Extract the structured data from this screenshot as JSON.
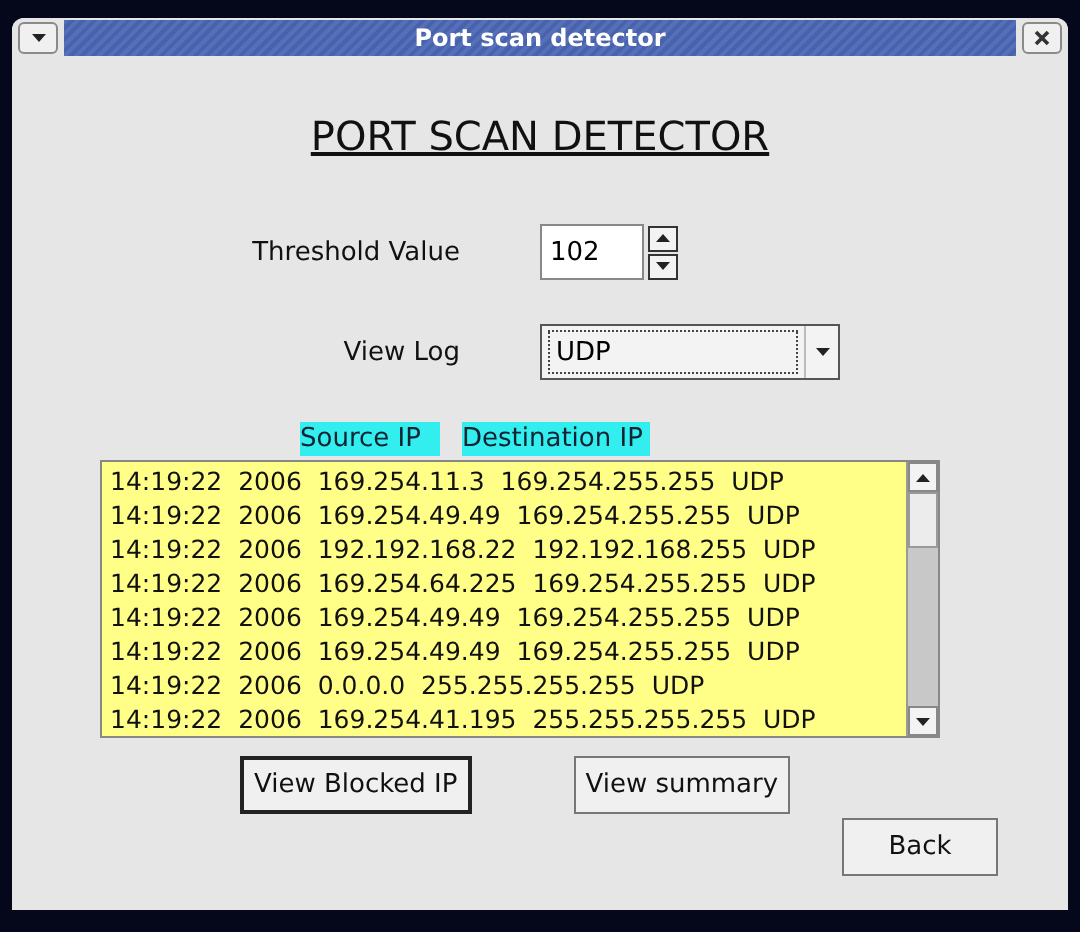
{
  "window": {
    "title": "Port scan detector"
  },
  "heading": "PORT SCAN DETECTOR",
  "threshold": {
    "label": "Threshold Value",
    "value": "102"
  },
  "view_log": {
    "label": "View Log",
    "value": "UDP"
  },
  "column_headers": [
    "Source IP",
    "Destination IP"
  ],
  "log_rows": [
    {
      "time": "14:19:22",
      "year": "2006",
      "source": "169.254.11.3",
      "destination": "169.254.255.255",
      "protocol": "UDP"
    },
    {
      "time": "14:19:22",
      "year": "2006",
      "source": "169.254.49.49",
      "destination": "169.254.255.255",
      "protocol": "UDP"
    },
    {
      "time": "14:19:22",
      "year": "2006",
      "source": "192.192.168.22",
      "destination": "192.192.168.255",
      "protocol": "UDP"
    },
    {
      "time": "14:19:22",
      "year": "2006",
      "source": "169.254.64.225",
      "destination": "169.254.255.255",
      "protocol": "UDP"
    },
    {
      "time": "14:19:22",
      "year": "2006",
      "source": "169.254.49.49",
      "destination": "169.254.255.255",
      "protocol": "UDP"
    },
    {
      "time": "14:19:22",
      "year": "2006",
      "source": "169.254.49.49",
      "destination": "169.254.255.255",
      "protocol": "UDP"
    },
    {
      "time": "14:19:22",
      "year": "2006",
      "source": "0.0.0.0",
      "destination": "255.255.255.255",
      "protocol": "UDP"
    },
    {
      "time": "14:19:22",
      "year": "2006",
      "source": "169.254.41.195",
      "destination": "255.255.255.255",
      "protocol": "UDP"
    }
  ],
  "buttons": [
    {
      "label": "View Blocked IP",
      "focused": true
    },
    {
      "label": "View summary",
      "focused": false
    }
  ],
  "back_button": "Back"
}
